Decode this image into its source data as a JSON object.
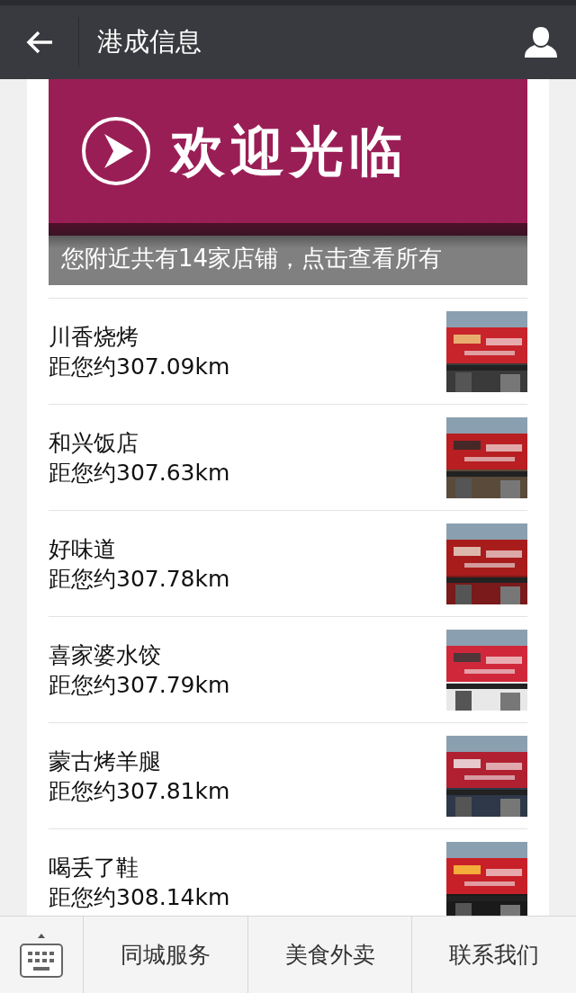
{
  "header": {
    "title": "港成信息"
  },
  "banner": {
    "headline": "欢迎光临",
    "caption": "您附近共有14家店铺，点击查看所有"
  },
  "shops": [
    {
      "name": "川香烧烤",
      "distance": "距您约307.09km"
    },
    {
      "name": "和兴饭店",
      "distance": "距您约307.63km"
    },
    {
      "name": "好味道",
      "distance": "距您约307.78km"
    },
    {
      "name": "喜家婆水饺",
      "distance": "距您约307.79km"
    },
    {
      "name": "蒙古烤羊腿",
      "distance": "距您约307.81km"
    },
    {
      "name": "喝丢了鞋",
      "distance": "距您约308.14km"
    }
  ],
  "bottom_menu": [
    "同城服务",
    "美食外卖",
    "联系我们"
  ]
}
